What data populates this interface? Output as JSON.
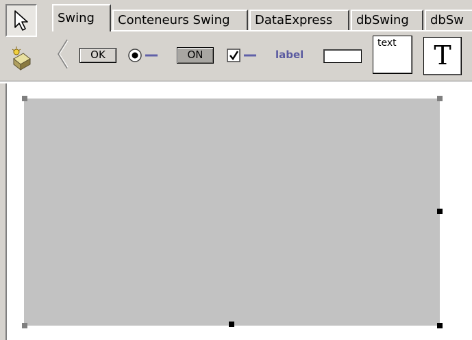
{
  "toolbar": {
    "tools": [
      {
        "name": "selection-tool",
        "icon": "arrow-pointer-icon",
        "pressed": true
      },
      {
        "name": "bean-chooser",
        "icon": "bean-chooser-icon",
        "pressed": false
      }
    ]
  },
  "tabs": [
    {
      "label": "Swing",
      "active": true
    },
    {
      "label": "Conteneurs Swing",
      "active": false
    },
    {
      "label": "DataExpress",
      "active": false
    },
    {
      "label": "dbSwing",
      "active": false
    },
    {
      "label": "dbSw",
      "active": false
    }
  ],
  "palette": {
    "button_label": "OK",
    "toggle_label": "ON",
    "label_text": "label",
    "textarea_text": "text",
    "textpane_glyph": "T"
  },
  "colors": {
    "background": "#d6d3ce",
    "panel": "#c2c2c2",
    "label_accent": "#5a5aa0"
  }
}
